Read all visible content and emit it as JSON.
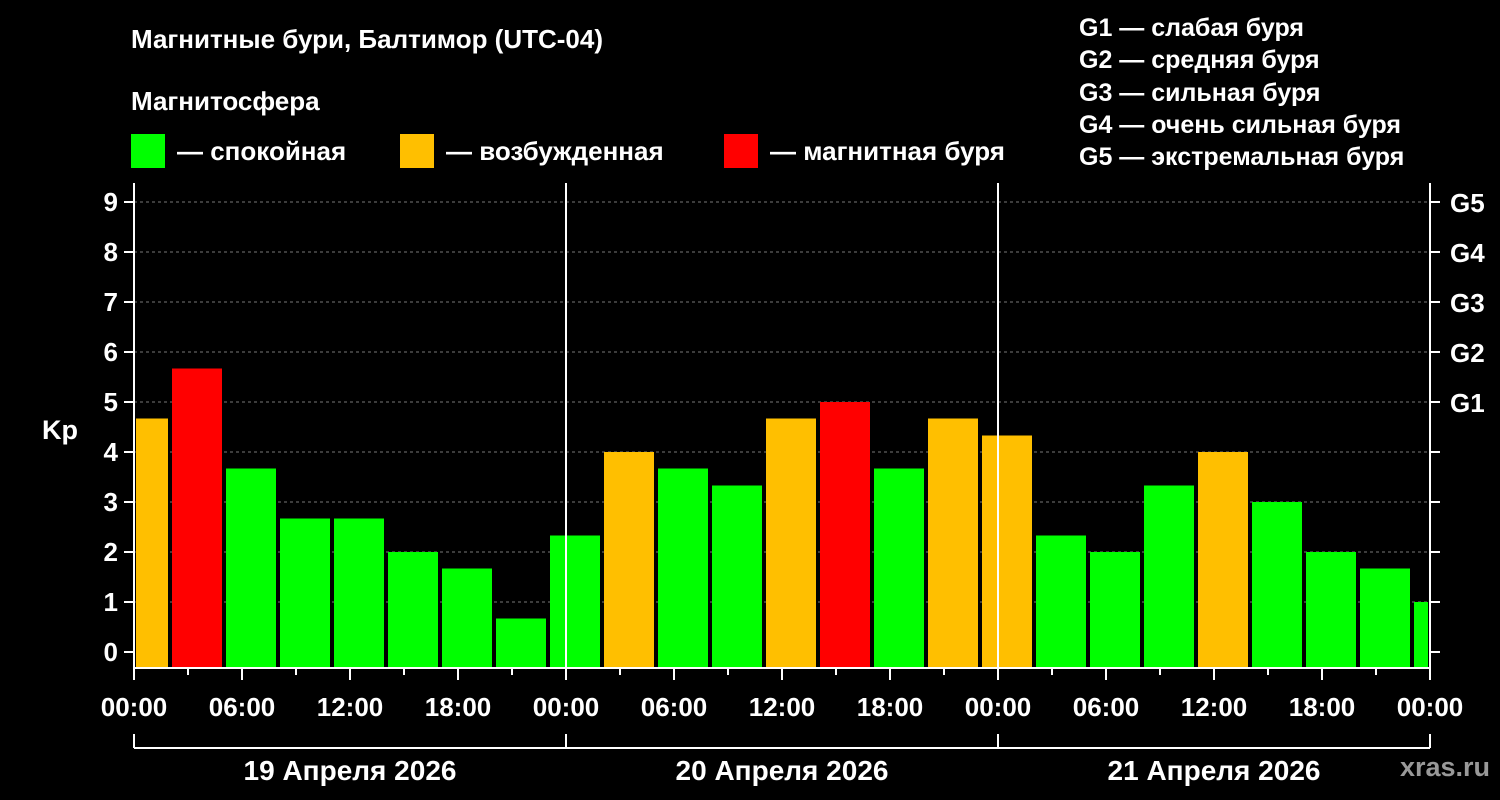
{
  "header": {
    "title": "Магнитные бури, Балтимор (UTC-04)",
    "subtitle": "Магнитосфера"
  },
  "legend": [
    {
      "label": "— спокойная",
      "color": "#00ff00"
    },
    {
      "label": "— возбужденная",
      "color": "#ffbf00"
    },
    {
      "label": "— магнитная буря",
      "color": "#ff0000"
    }
  ],
  "storm_scale": [
    "G1 — слабая буря",
    "G2 — средняя буря",
    "G3 — сильная буря",
    "G4 — очень сильная буря",
    "G5 — экстремальная буря"
  ],
  "watermark": "xras.ru",
  "chart_data": {
    "type": "bar",
    "ylabel": "Kp",
    "ylim": [
      0,
      9
    ],
    "yticks": [
      "0",
      "1",
      "2",
      "3",
      "4",
      "5",
      "6",
      "7",
      "8",
      "9"
    ],
    "g_levels": [
      {
        "label": "G1",
        "kp": 5
      },
      {
        "label": "G2",
        "kp": 6
      },
      {
        "label": "G3",
        "kp": 7
      },
      {
        "label": "G4",
        "kp": 8
      },
      {
        "label": "G5",
        "kp": 9
      }
    ],
    "grid": true,
    "xticks": [
      "00:00",
      "06:00",
      "12:00",
      "18:00",
      "00:00",
      "06:00",
      "12:00",
      "18:00",
      "00:00",
      "06:00",
      "12:00",
      "18:00",
      "00:00"
    ],
    "days": [
      "19 Апреля 2026",
      "20 Апреля 2026",
      "21 Апреля 2026"
    ],
    "start_hour": -1,
    "bar_hours": 3,
    "total_hours": 72,
    "values": [
      4.67,
      5.67,
      3.67,
      2.67,
      2.67,
      2.0,
      1.67,
      0.67,
      2.33,
      4.0,
      3.67,
      3.33,
      4.67,
      5.0,
      3.67,
      4.67,
      4.33,
      2.33,
      2.0,
      3.33,
      4.0,
      3.0,
      2.0,
      1.67,
      1.0
    ],
    "colors": {
      "quiet": "#00ff00",
      "active": "#ffbf00",
      "storm": "#ff0000"
    }
  }
}
